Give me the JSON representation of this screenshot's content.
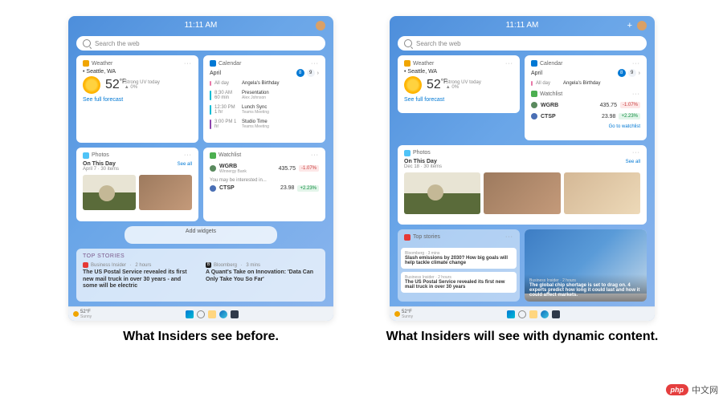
{
  "header": {
    "time": "11:11 AM"
  },
  "search": {
    "placeholder": "Search the web"
  },
  "weather": {
    "card_title": "Weather",
    "location": "Seattle, WA",
    "temp": "52",
    "unit": "°F",
    "uv": "Strong UV today",
    "high_low": "▲ 0%",
    "link": "See full forecast"
  },
  "calendar": {
    "card_title": "Calendar",
    "month": "April",
    "selected_day": "8",
    "next_day": "9",
    "events": [
      {
        "time": "All day",
        "label": "Angela's Birthday",
        "color": "pink"
      },
      {
        "time": "8:30 AM\n60 min",
        "label": "Presentation",
        "sub": "Alex Johnson",
        "color": "teal"
      },
      {
        "time": "12:30 PM\n1 hr",
        "label": "Lunch Sync",
        "sub": "Teams Meeting",
        "color": "teal"
      },
      {
        "time": "3:00 PM\n1 hr",
        "label": "Studio Time",
        "sub": "Teams Meeting",
        "color": "purple"
      }
    ],
    "events_short": [
      {
        "time": "All day",
        "label": "Angela's Birthday",
        "color": "pink"
      },
      {
        "time": "8:30 AM\n60 min",
        "label": "Presentation",
        "sub": "Alex Johnson",
        "color": "teal"
      }
    ]
  },
  "photos": {
    "card_title": "Photos",
    "on_this_day": "On This Day",
    "date_a": "April 7 · 30 items",
    "date_b": "Dec 18 · 30 items",
    "see_all": "See all"
  },
  "watchlist": {
    "card_title": "Watchlist",
    "note": "You may be interested in...",
    "link": "Go to watchlist",
    "rows": [
      {
        "symbol": "WGRB",
        "name": "Winnergy Bank",
        "price": "435.75",
        "change": "-1.07%",
        "dir": "down",
        "color": "#5a8a5e"
      },
      {
        "symbol": "CTSP",
        "name": "",
        "price": "23.98",
        "change": "+2.23%",
        "dir": "up",
        "color": "#4a6fb5"
      }
    ]
  },
  "add_widgets": "Add widgets",
  "topstories": {
    "section_title": "TOP STORIES",
    "card_title": "Top stories",
    "a": {
      "source": "Business Insider",
      "age": "2 hours",
      "headline": "The US Postal Service revealed its first new mail truck in over 30 years - and some will be electric"
    },
    "b": {
      "source": "Bloomberg",
      "age": "3 mins",
      "headline": "A Quant's Take on Innovation: 'Data Can Only Take You So Far'"
    },
    "c": {
      "source": "Bloomberg",
      "age": "3 mins",
      "headline": "Slash emissions by 2030? How big goals will help tackle climate change"
    },
    "d": {
      "source": "Business Insider",
      "age": "2 hours",
      "headline": "The US Postal Service revealed its first new mail truck in over 30 years"
    },
    "e": {
      "source": "Business Insider",
      "age": "2 hours",
      "headline": "The global chip shortage is set to drag on. 4 experts predict how long it could last and how it could affect markets."
    }
  },
  "taskbar": {
    "temp": "52°F",
    "cond": "Sunny"
  },
  "captions": {
    "before": "What Insiders see before.",
    "after": "What Insiders will see with dynamic content."
  },
  "watermark": {
    "logo": "php",
    "text": "中文网"
  }
}
